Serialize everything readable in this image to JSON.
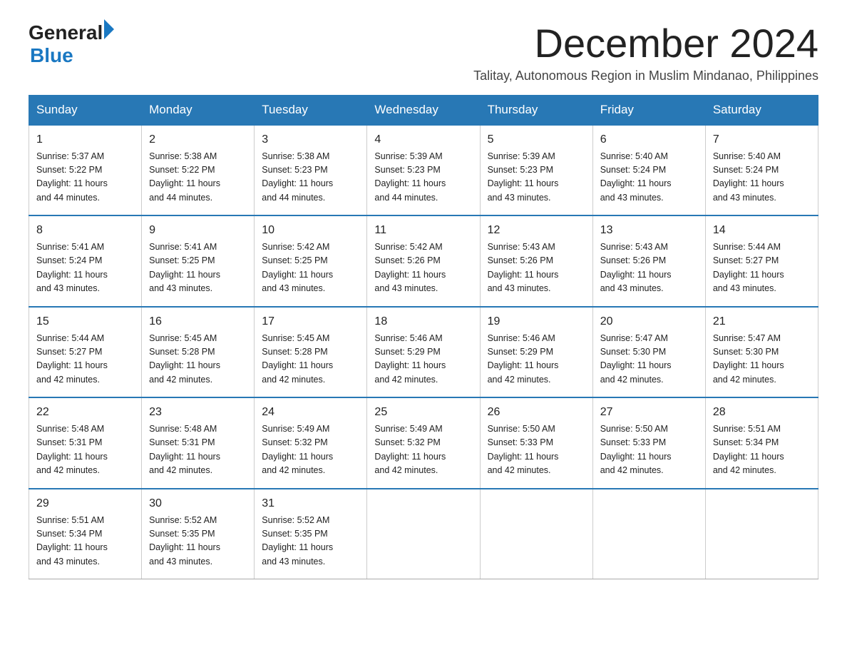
{
  "logo": {
    "text_general": "General",
    "arrow": "▶",
    "text_blue": "Blue"
  },
  "title": "December 2024",
  "subtitle": "Talitay, Autonomous Region in Muslim Mindanao, Philippines",
  "days_of_week": [
    "Sunday",
    "Monday",
    "Tuesday",
    "Wednesday",
    "Thursday",
    "Friday",
    "Saturday"
  ],
  "weeks": [
    [
      {
        "day": "1",
        "sunrise": "5:37 AM",
        "sunset": "5:22 PM",
        "daylight": "11 hours and 44 minutes."
      },
      {
        "day": "2",
        "sunrise": "5:38 AM",
        "sunset": "5:22 PM",
        "daylight": "11 hours and 44 minutes."
      },
      {
        "day": "3",
        "sunrise": "5:38 AM",
        "sunset": "5:23 PM",
        "daylight": "11 hours and 44 minutes."
      },
      {
        "day": "4",
        "sunrise": "5:39 AM",
        "sunset": "5:23 PM",
        "daylight": "11 hours and 44 minutes."
      },
      {
        "day": "5",
        "sunrise": "5:39 AM",
        "sunset": "5:23 PM",
        "daylight": "11 hours and 43 minutes."
      },
      {
        "day": "6",
        "sunrise": "5:40 AM",
        "sunset": "5:24 PM",
        "daylight": "11 hours and 43 minutes."
      },
      {
        "day": "7",
        "sunrise": "5:40 AM",
        "sunset": "5:24 PM",
        "daylight": "11 hours and 43 minutes."
      }
    ],
    [
      {
        "day": "8",
        "sunrise": "5:41 AM",
        "sunset": "5:24 PM",
        "daylight": "11 hours and 43 minutes."
      },
      {
        "day": "9",
        "sunrise": "5:41 AM",
        "sunset": "5:25 PM",
        "daylight": "11 hours and 43 minutes."
      },
      {
        "day": "10",
        "sunrise": "5:42 AM",
        "sunset": "5:25 PM",
        "daylight": "11 hours and 43 minutes."
      },
      {
        "day": "11",
        "sunrise": "5:42 AM",
        "sunset": "5:26 PM",
        "daylight": "11 hours and 43 minutes."
      },
      {
        "day": "12",
        "sunrise": "5:43 AM",
        "sunset": "5:26 PM",
        "daylight": "11 hours and 43 minutes."
      },
      {
        "day": "13",
        "sunrise": "5:43 AM",
        "sunset": "5:26 PM",
        "daylight": "11 hours and 43 minutes."
      },
      {
        "day": "14",
        "sunrise": "5:44 AM",
        "sunset": "5:27 PM",
        "daylight": "11 hours and 43 minutes."
      }
    ],
    [
      {
        "day": "15",
        "sunrise": "5:44 AM",
        "sunset": "5:27 PM",
        "daylight": "11 hours and 42 minutes."
      },
      {
        "day": "16",
        "sunrise": "5:45 AM",
        "sunset": "5:28 PM",
        "daylight": "11 hours and 42 minutes."
      },
      {
        "day": "17",
        "sunrise": "5:45 AM",
        "sunset": "5:28 PM",
        "daylight": "11 hours and 42 minutes."
      },
      {
        "day": "18",
        "sunrise": "5:46 AM",
        "sunset": "5:29 PM",
        "daylight": "11 hours and 42 minutes."
      },
      {
        "day": "19",
        "sunrise": "5:46 AM",
        "sunset": "5:29 PM",
        "daylight": "11 hours and 42 minutes."
      },
      {
        "day": "20",
        "sunrise": "5:47 AM",
        "sunset": "5:30 PM",
        "daylight": "11 hours and 42 minutes."
      },
      {
        "day": "21",
        "sunrise": "5:47 AM",
        "sunset": "5:30 PM",
        "daylight": "11 hours and 42 minutes."
      }
    ],
    [
      {
        "day": "22",
        "sunrise": "5:48 AM",
        "sunset": "5:31 PM",
        "daylight": "11 hours and 42 minutes."
      },
      {
        "day": "23",
        "sunrise": "5:48 AM",
        "sunset": "5:31 PM",
        "daylight": "11 hours and 42 minutes."
      },
      {
        "day": "24",
        "sunrise": "5:49 AM",
        "sunset": "5:32 PM",
        "daylight": "11 hours and 42 minutes."
      },
      {
        "day": "25",
        "sunrise": "5:49 AM",
        "sunset": "5:32 PM",
        "daylight": "11 hours and 42 minutes."
      },
      {
        "day": "26",
        "sunrise": "5:50 AM",
        "sunset": "5:33 PM",
        "daylight": "11 hours and 42 minutes."
      },
      {
        "day": "27",
        "sunrise": "5:50 AM",
        "sunset": "5:33 PM",
        "daylight": "11 hours and 42 minutes."
      },
      {
        "day": "28",
        "sunrise": "5:51 AM",
        "sunset": "5:34 PM",
        "daylight": "11 hours and 42 minutes."
      }
    ],
    [
      {
        "day": "29",
        "sunrise": "5:51 AM",
        "sunset": "5:34 PM",
        "daylight": "11 hours and 43 minutes."
      },
      {
        "day": "30",
        "sunrise": "5:52 AM",
        "sunset": "5:35 PM",
        "daylight": "11 hours and 43 minutes."
      },
      {
        "day": "31",
        "sunrise": "5:52 AM",
        "sunset": "5:35 PM",
        "daylight": "11 hours and 43 minutes."
      },
      null,
      null,
      null,
      null
    ]
  ],
  "labels": {
    "sunrise": "Sunrise:",
    "sunset": "Sunset:",
    "daylight": "Daylight:"
  }
}
